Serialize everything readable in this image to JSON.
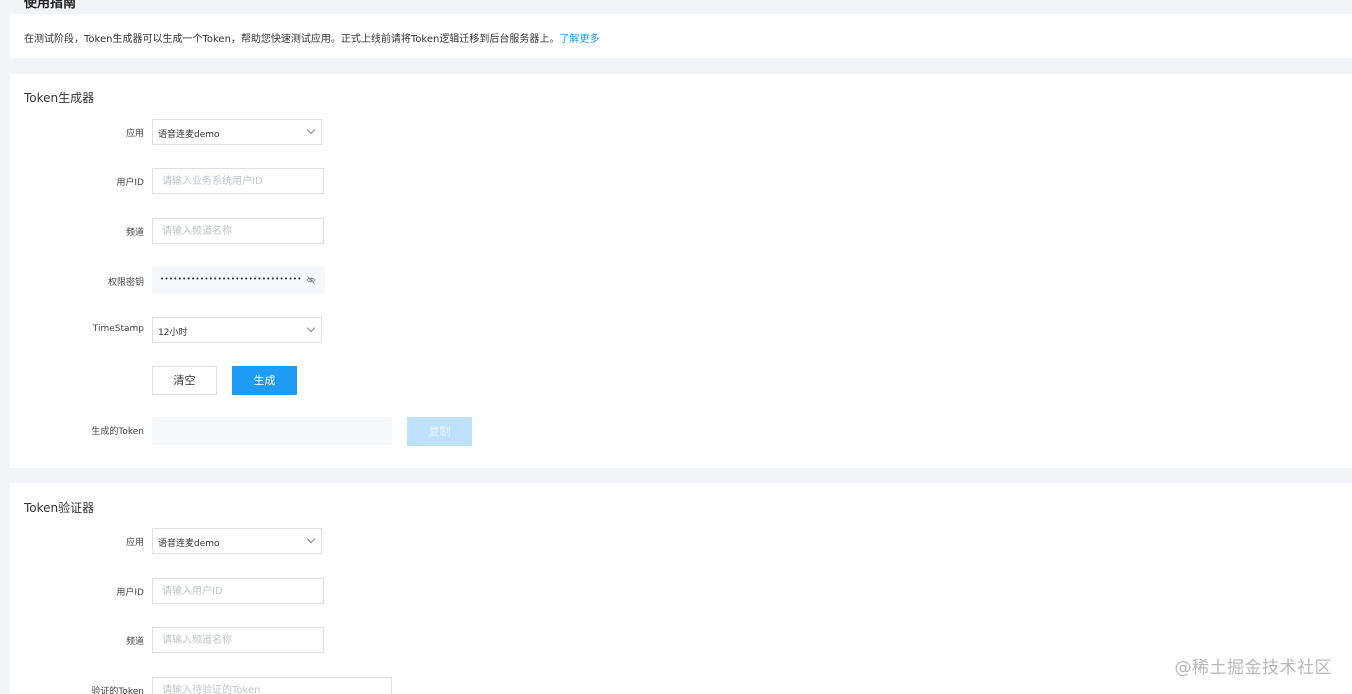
{
  "header": {
    "clipped_title": "使用指南"
  },
  "notice": {
    "text": "在测试阶段，Token生成器可以生成一个Token，帮助您快速测试应用。正式上线前请将Token逻辑迁移到后台服务器上。",
    "link": "了解更多"
  },
  "generator": {
    "title": "Token生成器",
    "app_label": "应用",
    "app_value": "语音连麦demo",
    "userid_label": "用户ID",
    "userid_placeholder": "请输入业务系统用户ID",
    "channel_label": "频道",
    "channel_placeholder": "请输入频道名称",
    "secret_label": "权限密钥",
    "secret_value": "••••••••••••••••••••••••••••••••",
    "timestamp_label": "TimeStamp",
    "timestamp_value": "12小时",
    "clear_button": "清空",
    "generate_button": "生成",
    "token_label": "生成的Token",
    "copy_button": "复制"
  },
  "verifier": {
    "title": "Token验证器",
    "app_label": "应用",
    "app_value": "语音连麦demo",
    "userid_label": "用户ID",
    "userid_placeholder": "请输入用户ID",
    "channel_label": "频道",
    "channel_placeholder": "请输入频道名称",
    "token_label": "验证的Token",
    "token_placeholder": "请输入待验证的Token"
  },
  "watermark": "@稀土掘金技术社区"
}
